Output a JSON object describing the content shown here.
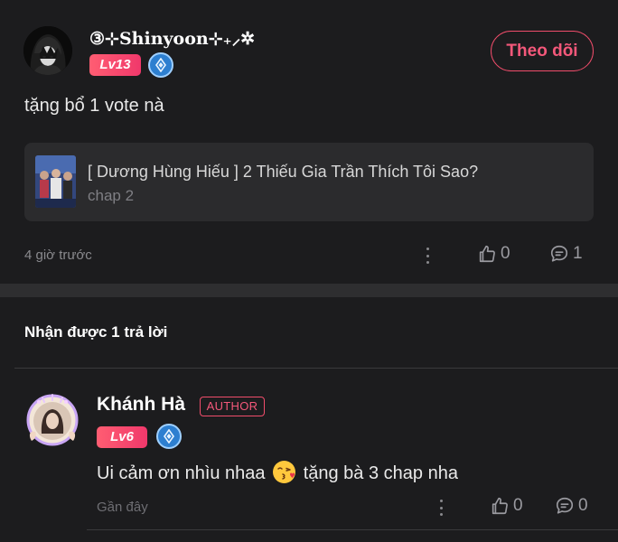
{
  "comment": {
    "username": "③⊹Shinyoon⊹₊⸝✲",
    "level": "Lv13",
    "follow_label": "Theo dõi",
    "text": "tặng bổ 1 vote nà",
    "chapter": {
      "title": "[ Dương Hùng Hiếu ] 2 Thiếu Gia Trần Thích Tôi Sao?",
      "subtitle": "chap 2"
    },
    "time": "4 giờ trước",
    "likes": "0",
    "replies": "1"
  },
  "replies_heading": "Nhận được 1 trả lời",
  "reply": {
    "username": "Khánh Hà",
    "author_tag": "AUTHOR",
    "level": "Lv6",
    "text_before": "Ui cảm ơn nhìu nhaa",
    "emoji": "kissing-face-emoji",
    "text_after": "tặng bà 3 chap nha",
    "time": "Gần đây",
    "likes": "0",
    "replies": "0"
  },
  "colors": {
    "background": "#1c1c1e",
    "accent": "#f04d6b",
    "card": "#2b2b2d",
    "muted": "#8a8a8e"
  }
}
